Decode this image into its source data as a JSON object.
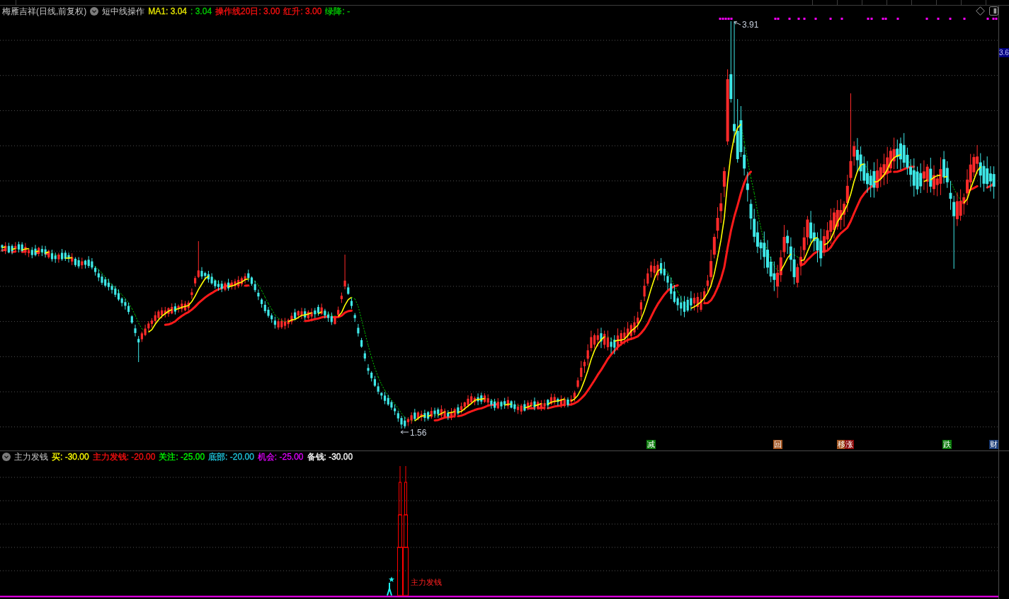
{
  "main_panel": {
    "title": "梅雁吉祥(日线,前复权)",
    "indicator": "短中线操作",
    "legend": [
      {
        "text": "MA1: 3.04",
        "color": "#e6e600"
      },
      {
        "text": ": 3.04",
        "color": "#00d000"
      },
      {
        "text": "操作线20日: 3.00",
        "color": "#ff1010"
      },
      {
        "text": "红升: 3.00",
        "color": "#ff1010"
      },
      {
        "text": "绿降: -",
        "color": "#00d000"
      }
    ],
    "high_label": "3.91",
    "low_label": "1.56",
    "price_tag": "3.6",
    "signals": [
      {
        "text": "减",
        "color": "#0a7a0a"
      },
      {
        "text": "回",
        "color": "#a0521e"
      },
      {
        "text": "移",
        "color": "#a0521e"
      },
      {
        "text": "涨",
        "color": "#8b0a0a"
      },
      {
        "text": "跌",
        "color": "#0a7a0a"
      },
      {
        "text": "财",
        "color": "#1a3c78"
      }
    ]
  },
  "sub_panel": {
    "title": "主力发钱",
    "legend": [
      {
        "text": "买: -30.00",
        "color": "#ffff00"
      },
      {
        "text": "主力发钱: -20.00",
        "color": "#ff1010"
      },
      {
        "text": "关注: -25.00",
        "color": "#00ff00"
      },
      {
        "text": "底部: -20.00",
        "color": "#20c8e0"
      },
      {
        "text": "机会: -25.00",
        "color": "#e000ff"
      },
      {
        "text": "备钱: -30.00",
        "color": "#ffffff"
      }
    ],
    "signal_label": "主力发钱"
  }
}
